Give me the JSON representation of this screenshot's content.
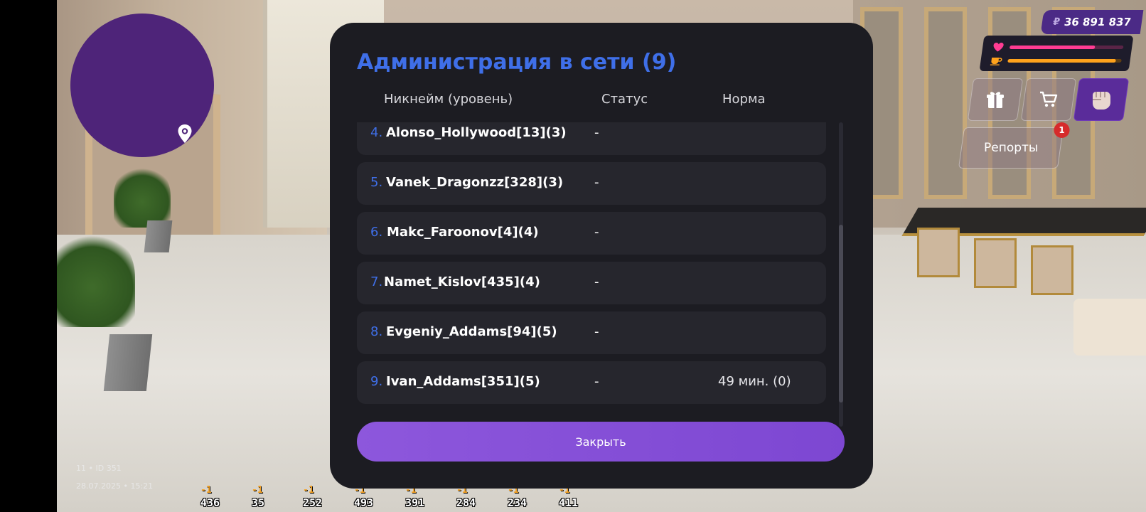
{
  "hud": {
    "money_currency": "₽",
    "money": "36 891 837",
    "health_fraction": 0.75,
    "hunger_fraction": 0.95,
    "reports_label": "Репорты",
    "reports_badge": "1",
    "accent_purple": "#4e2479"
  },
  "info": {
    "line1": "11 • ID 351",
    "line2": "28.07.2025 • 15:21"
  },
  "slots": [
    {
      "delta": "-1",
      "num": "436"
    },
    {
      "delta": "-1",
      "num": "35"
    },
    {
      "delta": "-1",
      "num": "252"
    },
    {
      "delta": "-1",
      "num": "493"
    },
    {
      "delta": "-1",
      "num": "391"
    },
    {
      "delta": "-1",
      "num": "284"
    },
    {
      "delta": "-1",
      "num": "234"
    },
    {
      "delta": "-1",
      "num": "411"
    }
  ],
  "modal": {
    "title": "Администрация в сети (9)",
    "columns": [
      "Никнейм (уровень)",
      "Статус",
      "Норма"
    ],
    "rows": [
      {
        "idx": "4.",
        "nick": "Alonso_Hollywood[13](3)",
        "status": "-",
        "norm": ""
      },
      {
        "idx": "5.",
        "nick": "Vanek_Dragonzz[328](3)",
        "status": "-",
        "norm": ""
      },
      {
        "idx": "6.",
        "nick": "Makc_Faroonov[4](4)",
        "status": "-",
        "norm": ""
      },
      {
        "idx": "7.",
        "nick": "Namet_Kislov[435](4)",
        "status": "-",
        "norm": ""
      },
      {
        "idx": "8.",
        "nick": "Evgeniy_Addams[94](5)",
        "status": "-",
        "norm": ""
      },
      {
        "idx": "9.",
        "nick": "Ivan_Addams[351](5)",
        "status": "-",
        "norm": "49 мин. (0)"
      }
    ],
    "close_label": "Закрыть"
  }
}
